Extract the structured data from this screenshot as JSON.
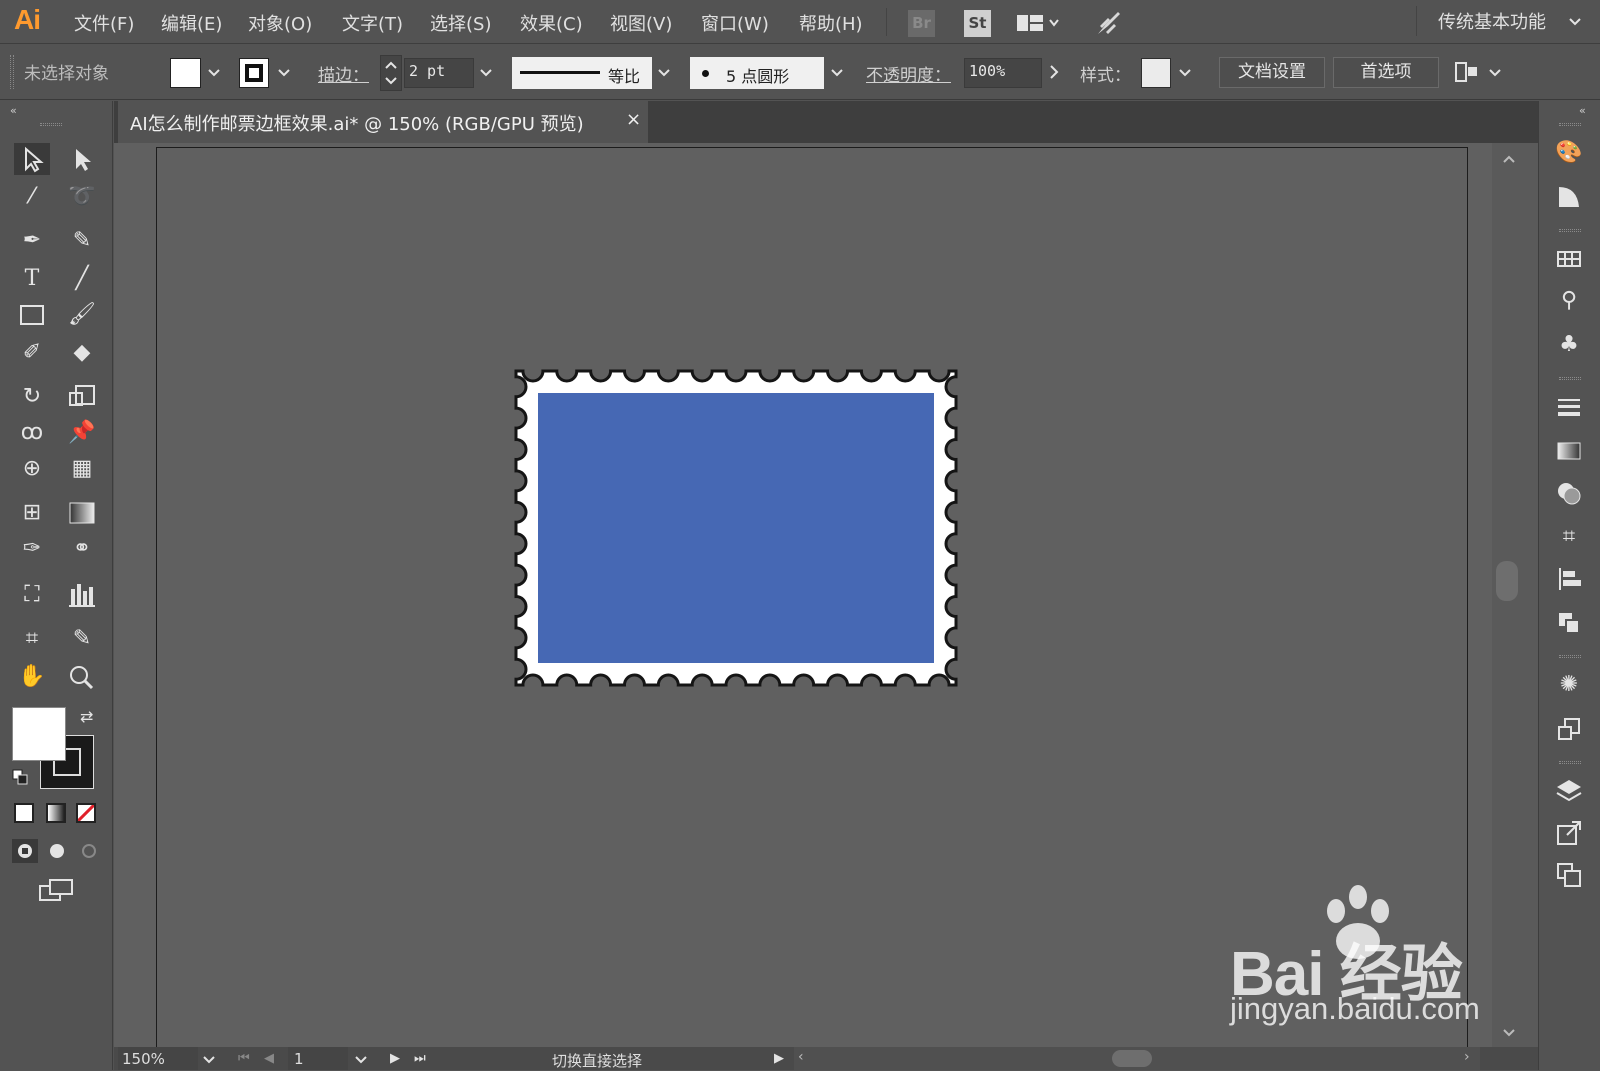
{
  "app": {
    "logo": "Ai",
    "accent": "#ff9a2e"
  },
  "menu": [
    {
      "label": "文件(F)"
    },
    {
      "label": "编辑(E)"
    },
    {
      "label": "对象(O)"
    },
    {
      "label": "文字(T)"
    },
    {
      "label": "选择(S)"
    },
    {
      "label": "效果(C)"
    },
    {
      "label": "视图(V)"
    },
    {
      "label": "窗口(W)"
    },
    {
      "label": "帮助(H)"
    }
  ],
  "badges": {
    "bridge": "Br",
    "stock": "St"
  },
  "workspace_label": "传统基本功能",
  "control": {
    "selection_status": "未选择对象",
    "stroke_label": "描边：",
    "stroke_weight": "2 pt",
    "stroke_profile": "等比",
    "brush": "5 点圆形",
    "opacity_label": "不透明度：",
    "opacity_value": "100%",
    "style_label": "样式：",
    "doc_setup_button": "文档设置",
    "preferences_button": "首选项",
    "fill_color": "#ffffff"
  },
  "document_tab": {
    "title": "AI怎么制作邮票边框效果.ai* @ 150% (RGB/GPU 预览)",
    "close": "×"
  },
  "artwork": {
    "stamp_fill": "#4668b4",
    "stamp_border": "#ffffff"
  },
  "status": {
    "zoom": "150%",
    "page": "1",
    "tool_hint": "切换直接选择"
  },
  "watermark": {
    "brand": "Bai  经验",
    "url": "jingyan.baidu.com"
  }
}
